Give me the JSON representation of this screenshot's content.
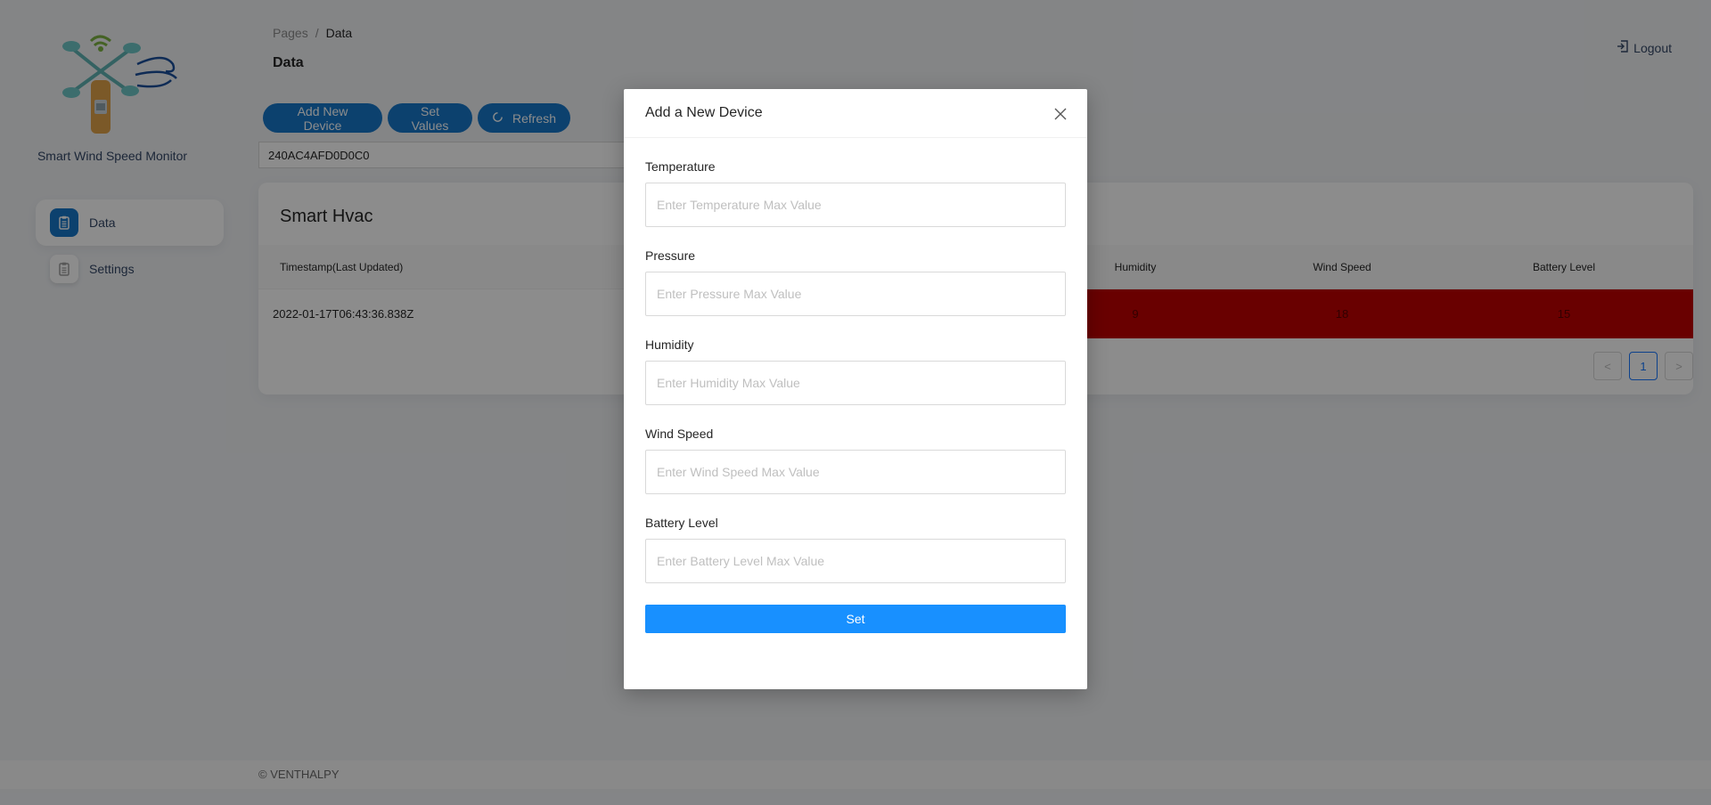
{
  "sidebar": {
    "brand": "Smart Wind Speed Monitor",
    "items": [
      {
        "label": "Data",
        "active": true
      },
      {
        "label": "Settings",
        "active": false
      }
    ]
  },
  "header": {
    "breadcrumb_root": "Pages",
    "breadcrumb_sep": "/",
    "breadcrumb_current": "Data",
    "title": "Data",
    "logout": "Logout"
  },
  "toolbar": {
    "add_device": "Add New Device",
    "set_values": "Set Values",
    "refresh": "Refresh"
  },
  "device_select": {
    "value": "240AC4AFD0D0C0"
  },
  "card": {
    "title": "Smart Hvac",
    "columns": {
      "timestamp": "Timestamp(Last Updated)",
      "humidity": "Humidity",
      "wind_speed": "Wind Speed",
      "battery_level": "Battery Level"
    },
    "row": {
      "timestamp": "2022-01-17T06:43:36.838Z",
      "humidity": "9",
      "wind_speed": "18",
      "battery_level": "15"
    },
    "alert_color": "#c00000",
    "pager": {
      "prev": "<",
      "page": "1",
      "next": ">"
    }
  },
  "footer": "© VENTHALPY",
  "modal": {
    "title": "Add a New Device",
    "fields": [
      {
        "label": "Temperature",
        "placeholder": "Enter Temperature Max Value"
      },
      {
        "label": "Pressure",
        "placeholder": "Enter Pressure Max Value"
      },
      {
        "label": "Humidity",
        "placeholder": "Enter Humidity Max Value"
      },
      {
        "label": "Wind Speed",
        "placeholder": "Enter Wind Speed Max Value"
      },
      {
        "label": "Battery Level",
        "placeholder": "Enter Battery Level Max Value"
      }
    ],
    "submit": "Set"
  },
  "colors": {
    "primary": "#1677c9",
    "modal_button": "#1890ff"
  },
  "icons": [
    "app-logo",
    "clipboard-icon",
    "logout-icon",
    "refresh-icon",
    "close-icon"
  ]
}
